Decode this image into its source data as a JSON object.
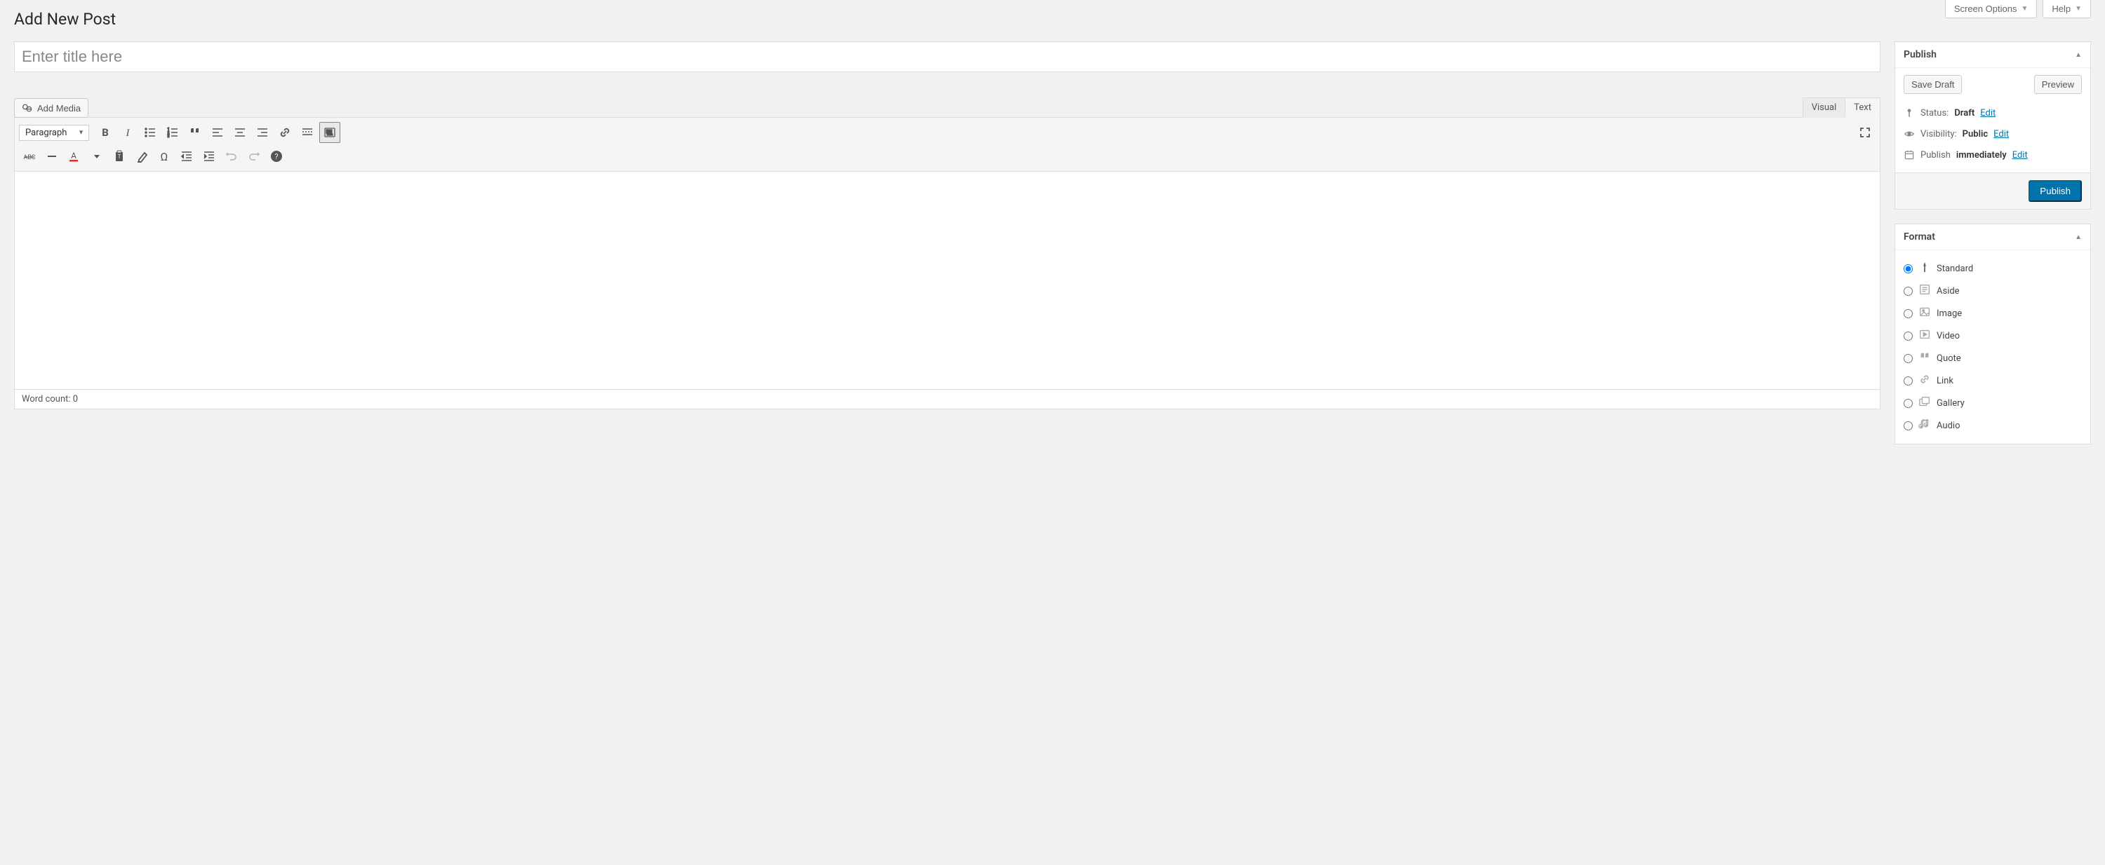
{
  "topTabs": {
    "screenOptions": "Screen Options",
    "help": "Help"
  },
  "pageTitle": "Add New Post",
  "titlePlaceholder": "Enter title here",
  "addMedia": "Add Media",
  "editorTabs": {
    "visual": "Visual",
    "text": "Text"
  },
  "formatSelect": "Paragraph",
  "wordCount": "Word count: 0",
  "publish": {
    "title": "Publish",
    "saveDraft": "Save Draft",
    "preview": "Preview",
    "statusLabel": "Status:",
    "statusValue": "Draft",
    "visibilityLabel": "Visibility:",
    "visibilityValue": "Public",
    "scheduleLabel": "Publish",
    "scheduleValue": "immediately",
    "edit": "Edit",
    "publishBtn": "Publish"
  },
  "format": {
    "title": "Format",
    "options": [
      "Standard",
      "Aside",
      "Image",
      "Video",
      "Quote",
      "Link",
      "Gallery",
      "Audio"
    ],
    "selected": "Standard"
  }
}
